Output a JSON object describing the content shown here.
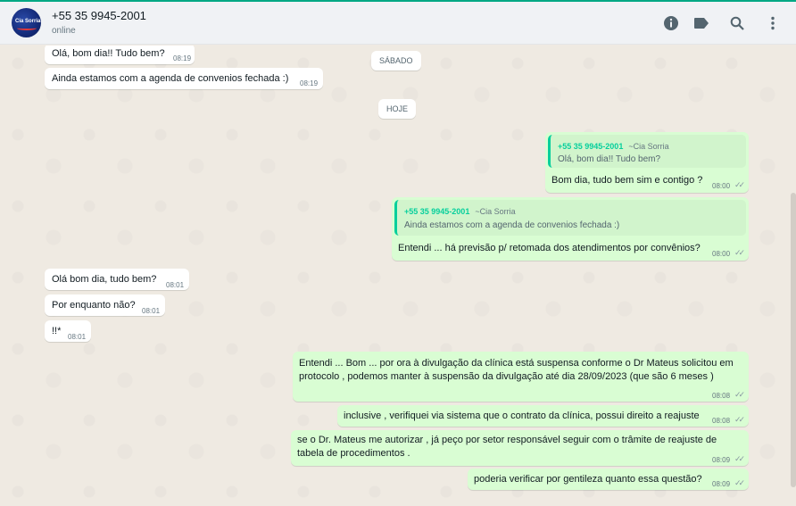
{
  "header": {
    "contact_name": "+55 35 9945-2001",
    "status": "online",
    "avatar_text": "Cia Sorria",
    "icons": [
      "info-icon",
      "label-icon",
      "search-icon",
      "menu-icon"
    ]
  },
  "colors": {
    "accent": "#00a884",
    "incoming": "#ffffff",
    "outgoing": "#d9fdd3",
    "header_bg": "#f0f2f5"
  },
  "messages": {
    "m1": {
      "text": "Olá, bom dia!! Tudo bem?",
      "time": "08:19"
    },
    "m2": {
      "text": "Ainda estamos com a agenda de convenios fechada  :)",
      "time": "08:19"
    },
    "date_saturday": "SÁBADO",
    "date_today": "HOJE",
    "m3": {
      "quote_author": "+55 35 9945-2001",
      "quote_org": "~Cia Sorria",
      "quote_text": "Olá, bom dia!! Tudo bem?",
      "text": "Bom dia, tudo bem sim e contigo ?",
      "time": "08:00"
    },
    "m4": {
      "quote_author": "+55 35 9945-2001",
      "quote_org": "~Cia Sorria",
      "quote_text": "Ainda estamos com a agenda de convenios fechada  :)",
      "text": "Entendi ... há previsão p/ retomada dos atendimentos por convênios?",
      "time": "08:00"
    },
    "m5": {
      "text": "Olá bom dia, tudo bem?",
      "time": "08:01"
    },
    "m6": {
      "text": "Por enquanto não?",
      "time": "08:01"
    },
    "m7": {
      "text": "!!*",
      "time": "08:01"
    },
    "m8": {
      "text": "Entendi ... Bom ... por ora à divulgação da clínica está suspensa conforme o Dr Mateus solicitou em protocolo , podemos manter à suspensão da divulgação até dia 28/09/2023 (que são 6 meses )",
      "time": "08:08"
    },
    "m9": {
      "text": "inclusive , verifiquei via sistema que o contrato da clínica, possui direito a reajuste",
      "time": "08:08"
    },
    "m10": {
      "text": "se o Dr. Mateus me autorizar , já peço por setor responsável seguir com o trâmite de reajuste de tabela de procedimentos .",
      "time": "08:09"
    },
    "m11": {
      "text": "poderia verificar por gentileza quanto essa questão?",
      "time": "08:09"
    }
  }
}
